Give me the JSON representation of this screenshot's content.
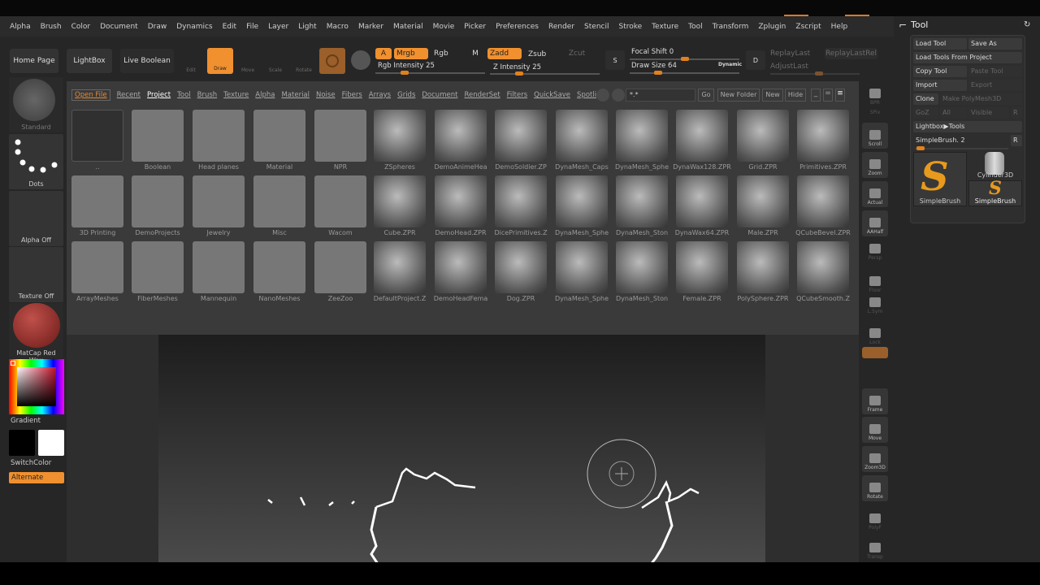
{
  "menu": [
    "Alpha",
    "Brush",
    "Color",
    "Document",
    "Draw",
    "Dynamics",
    "Edit",
    "File",
    "Layer",
    "Light",
    "Macro",
    "Marker",
    "Material",
    "Movie",
    "Picker",
    "Preferences",
    "Render",
    "Stencil",
    "Stroke",
    "Texture",
    "Tool",
    "Transform",
    "Zplugin",
    "Zscript",
    "Help"
  ],
  "toolbar": {
    "home_page": "Home Page",
    "lightbox": "LightBox",
    "live_boolean": "Live Boolean",
    "edit": "Edit",
    "draw": "Draw",
    "move": "Move",
    "scale": "Scale",
    "rotate": "Rotate",
    "a": "A",
    "mrgb": "Mrgb",
    "rgb": "Rgb",
    "m": "M",
    "zadd": "Zadd",
    "zsub": "Zsub",
    "zcut": "Zcut",
    "rgb_intensity": "Rgb Intensity 25",
    "z_intensity": "Z Intensity 25",
    "focal_shift": "Focal Shift 0",
    "draw_size": "Draw Size 64",
    "dynamic": "Dynamic",
    "replay_last": "ReplayLast",
    "replay_last_rel": "ReplayLastRel",
    "adjust_last": "AdjustLast",
    "rgb_intensity_value": 25,
    "z_intensity_value": 25,
    "focal_shift_value": 0,
    "draw_size_value": 64,
    "s_label": "S",
    "d_label": "D"
  },
  "left": {
    "brush": "Standard",
    "stroke": "Dots",
    "alpha": "Alpha Off",
    "texture": "Texture Off",
    "material": "MatCap Red Wax",
    "gradient": "Gradient",
    "switch_color": "SwitchColor",
    "alternate": "Alternate",
    "main_color": "#000000",
    "secondary_color": "#ffffff"
  },
  "lightbox": {
    "tabs": [
      "Open File",
      "Recent",
      "Project",
      "Tool",
      "Brush",
      "Texture",
      "Alpha",
      "Material",
      "Noise",
      "Fibers",
      "Arrays",
      "Grids",
      "Document",
      "RenderSet",
      "Filters",
      "QuickSave",
      "Spotlight"
    ],
    "active_tab": "Project",
    "search_value": "*.*",
    "go": "Go",
    "new_folder": "New Folder",
    "new": "New",
    "hide": "Hide",
    "rows": [
      [
        "..",
        "Boolean",
        "Head planes",
        "Material",
        "NPR",
        "ZSpheres",
        "DemoAnimeHea",
        "DemoSoldier.ZP",
        "DynaMesh_Caps",
        "DynaMesh_Sphe",
        "DynaWax128.ZPR",
        "Grid.ZPR",
        "Primitives.ZPR"
      ],
      [
        "3D Printing",
        "DemoProjects",
        "Jewelry",
        "Misc",
        "Wacom",
        "Cube.ZPR",
        "DemoHead.ZPR",
        "DicePrimitives.Z",
        "DynaMesh_Sphe",
        "DynaMesh_Ston",
        "DynaWax64.ZPR",
        "Male.ZPR",
        "QCubeBevel.ZPR"
      ],
      [
        "ArrayMeshes",
        "FiberMeshes",
        "Mannequin",
        "NanoMeshes",
        "ZeeZoo",
        "DefaultProject.Z",
        "DemoHeadFema",
        "Dog.ZPR",
        "DynaMesh_Sphe",
        "DynaMesh_Ston",
        "Female.ZPR",
        "PolySphere.ZPR",
        "QCubeSmooth.Z"
      ]
    ]
  },
  "right_shelf": [
    "BPR",
    "SPix",
    "Scroll",
    "Zoom",
    "Actual",
    "AAHalf",
    "Persp",
    "Floor",
    "L.Sym",
    "Lock",
    "Frame",
    "Move",
    "Zoom3D",
    "Rotate",
    "PolyF",
    "Transp"
  ],
  "tool_panel": {
    "title": "Tool",
    "load_tool": "Load Tool",
    "save_as": "Save As",
    "load_from_project": "Load Tools From Project",
    "copy_tool": "Copy Tool",
    "paste_tool": "Paste Tool",
    "import": "Import",
    "export": "Export",
    "clone": "Clone",
    "make_polymesh": "Make PolyMesh3D",
    "goz": "GoZ",
    "all": "All",
    "visible": "Visible",
    "r": "R",
    "lightbox_tools": "Lightbox▶Tools",
    "current_tool": "SimpleBrush. 2",
    "thumbs": [
      "SimpleBrush",
      "Cylinder3D",
      "SimpleBrush"
    ]
  }
}
